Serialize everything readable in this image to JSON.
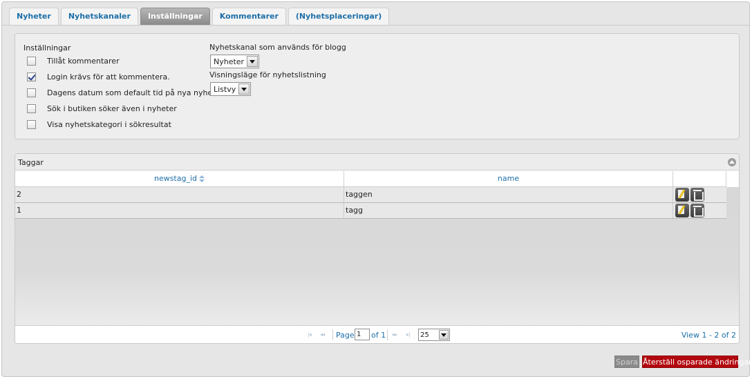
{
  "tabs": [
    {
      "label": "Nyheter"
    },
    {
      "label": "Nyhetskanaler"
    },
    {
      "label": "Inställningar"
    },
    {
      "label": "Kommentarer"
    },
    {
      "label": "(Nyhetsplaceringar)"
    }
  ],
  "settings": {
    "heading": "Inställningar",
    "checkboxes": [
      {
        "label": "Tillåt kommentarer",
        "checked": false
      },
      {
        "label": "Login krävs för att kommentera.",
        "checked": true
      },
      {
        "label": "Dagens datum som default tid på nya nyheter",
        "checked": false
      },
      {
        "label": "Sök i butiken söker även i nyheter",
        "checked": false
      },
      {
        "label": "Visa nyhetskategori i sökresultat",
        "checked": false
      }
    ],
    "blog_channel_label": "Nyhetskanal som används för blogg",
    "blog_channel_value": "Nyheter",
    "listing_mode_label": "Visningsläge för nyhetslistning",
    "listing_mode_value": "Listvy"
  },
  "tags_grid": {
    "title": "Taggar",
    "columns": [
      "newstag_id",
      "name"
    ],
    "rows": [
      {
        "id": "2",
        "name": "taggen"
      },
      {
        "id": "1",
        "name": "tagg"
      }
    ],
    "pager": {
      "page_label": "Page",
      "page_value": "1",
      "of_label": "of 1",
      "page_size": "25",
      "view_text": "View 1 - 2 of 2"
    }
  },
  "buttons": {
    "save": "Spara",
    "reset": "Återställ osparade ändringar"
  }
}
